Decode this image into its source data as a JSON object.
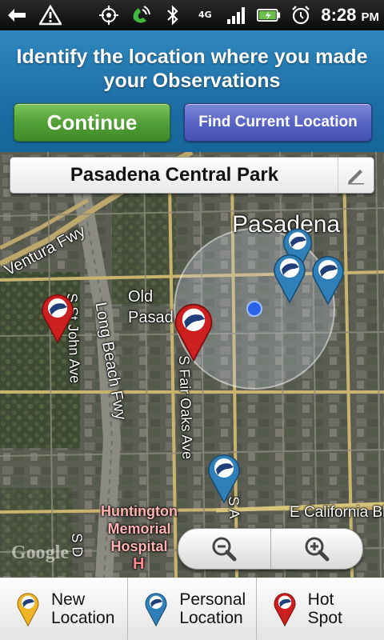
{
  "status_bar": {
    "time": "8:28",
    "ampm": "PM",
    "network": "4G",
    "icons": [
      "usb-icon",
      "warning-icon",
      "gps-icon",
      "phone-speaker-icon",
      "bluetooth-icon",
      "network-4g-icon",
      "signal-icon",
      "battery-icon",
      "alarm-icon"
    ]
  },
  "header": {
    "title": "Identify the location where you made your Observations",
    "continue_label": "Continue",
    "find_location_label": "Find Current Location"
  },
  "location_bar": {
    "name": "Pasadena Central Park",
    "edit_icon": "pencil-icon"
  },
  "map": {
    "labels": {
      "city": "Pasadena",
      "ventura_fwy": "Ventura Fwy",
      "old_pasadena": "Old\nPasad",
      "long_beach_fwy": "Long Beach Fwy",
      "john_ave": "S St John Ave",
      "fair_oaks": "S Fair Oaks Ave",
      "california_blvd": "E California Bl",
      "huntington": "Huntington\nMemorial\nHospital",
      "s_a": "S A",
      "s_d": "S D",
      "google": "Google"
    },
    "pins": [
      {
        "type": "new",
        "color": "#cc1f1f"
      },
      {
        "type": "new",
        "color": "#cc1f1f"
      },
      {
        "type": "personal",
        "color": "#2f7fb8"
      },
      {
        "type": "personal",
        "color": "#2f7fb8"
      },
      {
        "type": "personal",
        "color": "#2f7fb8"
      },
      {
        "type": "personal",
        "color": "#2f7fb8"
      },
      {
        "type": "personal",
        "color": "#2f7fb8"
      }
    ],
    "zoom_out_icon": "zoom-out-icon",
    "zoom_in_icon": "zoom-in-icon"
  },
  "tabs": [
    {
      "label": "New\nLocation",
      "pin_color": "#f0b429"
    },
    {
      "label": "Personal\nLocation",
      "pin_color": "#2f7fb8"
    },
    {
      "label": "Hot\nSpot",
      "pin_color": "#cc1f1f"
    }
  ]
}
